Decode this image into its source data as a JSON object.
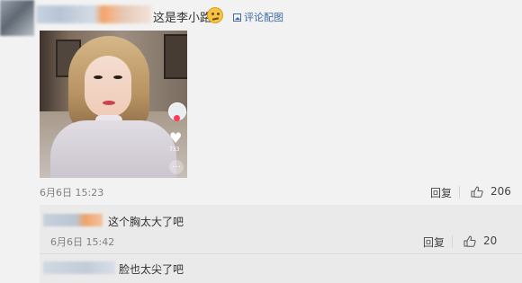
{
  "comment": {
    "text": "这是李小路",
    "comment_pic_label": "评论配图",
    "date": "6月6日 15:23",
    "reply_label": "回复",
    "like_count": "206"
  },
  "photo_overlay": {
    "heart_count": "733",
    "more_icon": "…"
  },
  "replies": [
    {
      "text": "这个胸太大了吧",
      "date": "6月6日 15:42",
      "reply_label": "回复",
      "like_count": "20"
    },
    {
      "text": "脸也太尖了吧"
    }
  ],
  "icons": {
    "comment_pic": "picture-icon",
    "like": "thumb-up-icon",
    "emoji": "smirk-emoji-icon",
    "heart": "heart-icon",
    "more": "more-icon"
  },
  "colors": {
    "background": "#f2f2f2",
    "reply_block": "#eaeaea",
    "link": "#3d6aa6"
  }
}
